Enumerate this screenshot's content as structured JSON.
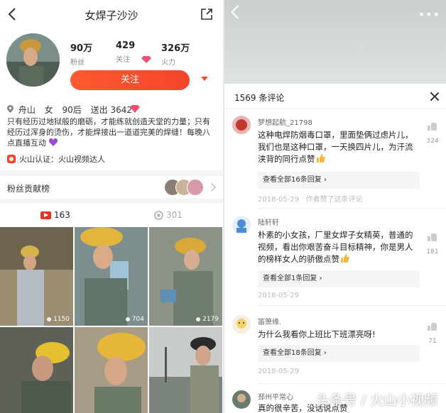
{
  "left": {
    "header": {
      "title": "女焊子沙沙"
    },
    "stats": [
      {
        "value": "90万",
        "label": "粉丝"
      },
      {
        "value": "429",
        "label": "关注"
      },
      {
        "value": "326万",
        "label": "火力"
      }
    ],
    "follow_label": "关注",
    "meta": {
      "location": "舟山",
      "gender": "女",
      "age": "90后",
      "gifts": "送出 3642"
    },
    "bio": "只有经历过地狱般的磨砺，才能练就创造天堂的力量；只有经历过浑身的烫伤，才能焊接出一道道完美的焊缝！每晚八点直播互动",
    "certification": "火山认证：火山视频达人",
    "fans_rank_label": "粉丝贡献榜",
    "tabs": [
      {
        "label": "163",
        "icon": "video-icon",
        "active": true
      },
      {
        "label": "301",
        "icon": "record-icon",
        "active": false
      }
    ],
    "videos": [
      {
        "count": "1150"
      },
      {
        "count": "704"
      },
      {
        "count": "2179"
      },
      {
        "count": ""
      },
      {
        "count": ""
      },
      {
        "count": ""
      }
    ]
  },
  "right": {
    "comment_count_title": "1569 条评论",
    "comments": [
      {
        "name": "梦想起航_21798",
        "text": "这种电焊防烟毒口罩，里面垫俩过虑片儿，我们也是这种口罩，一天换四片儿，为汗流浃背的同行点赞",
        "reply": "查看全部16条回复",
        "date": "2018-05-29",
        "author_liked": "作者赞了这条评论",
        "likes": "324"
      },
      {
        "name": "陆轩轩",
        "text": "朴素的小女孩，厂里女焊子女精英，普通的视频，看出你艰苦奋斗目标精神，你是男人的榜样女人的骄傲点赞",
        "reply": "查看全部1条回复",
        "date": "2018-05-29",
        "likes": "181"
      },
      {
        "name": "笛箫缘.",
        "text": "为什么我看你上班比下班漂亮呀!",
        "reply": "查看全部18条回复",
        "date": "2018-05-29",
        "likes": "71"
      },
      {
        "name": "邳州平常心",
        "text": "真的很辛苦，没话说点赞",
        "likes": ""
      }
    ],
    "watermark": "头条号 / 火山小视频"
  },
  "colors": {
    "accent": "#f5452c",
    "reply_link": "#333333",
    "muted": "#bbbbbb"
  }
}
